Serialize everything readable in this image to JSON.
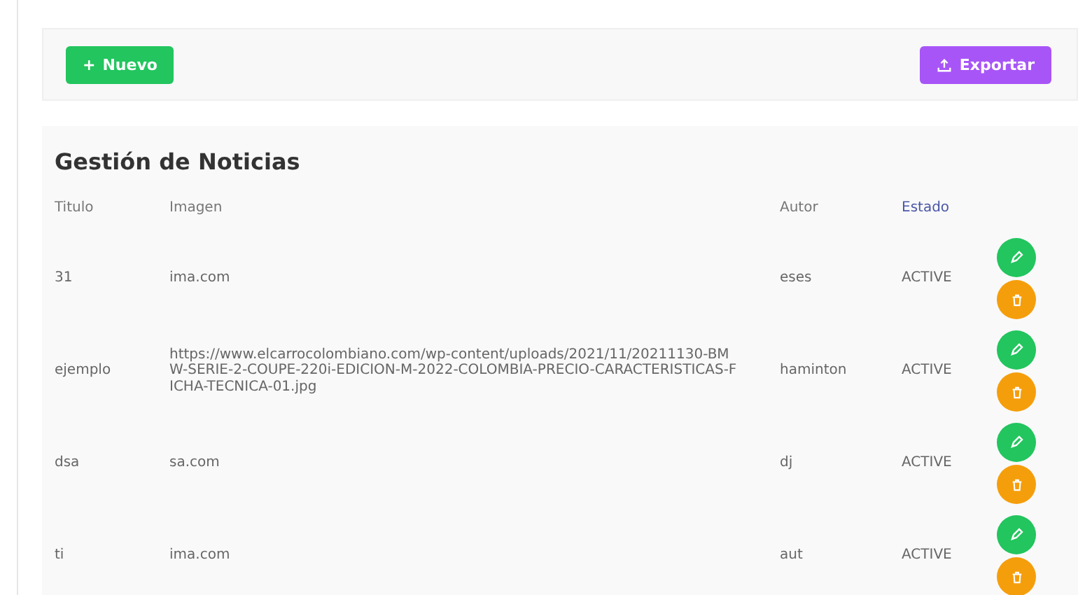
{
  "toolbar": {
    "new_button": {
      "icon": "+",
      "label": "Nuevo"
    },
    "export_button": {
      "label": "Exportar"
    }
  },
  "panel": {
    "title": "Gestión de Noticias"
  },
  "table": {
    "columns": [
      {
        "label": "Titulo",
        "sorted": false
      },
      {
        "label": "Imagen",
        "sorted": false
      },
      {
        "label": "Autor",
        "sorted": false
      },
      {
        "label": "Estado",
        "sorted": true
      }
    ],
    "rows": [
      {
        "titulo": "31",
        "imagen": "ima.com",
        "autor": "eses",
        "estado": "ACTIVE"
      },
      {
        "titulo": "ejemplo",
        "imagen": "https://www.elcarrocolombiano.com/wp-content/uploads/2021/11/20211130-BMW-SERIE-2-COUPE-220i-EDICION-M-2022-COLOMBIA-PRECIO-CARACTERISTICAS-FICHA-TECNICA-01.jpg",
        "autor": "haminton",
        "estado": "ACTIVE"
      },
      {
        "titulo": "dsa",
        "imagen": "sa.com",
        "autor": "dj",
        "estado": "ACTIVE"
      },
      {
        "titulo": "ti",
        "imagen": "ima.com",
        "autor": "aut",
        "estado": "ACTIVE"
      }
    ]
  }
}
